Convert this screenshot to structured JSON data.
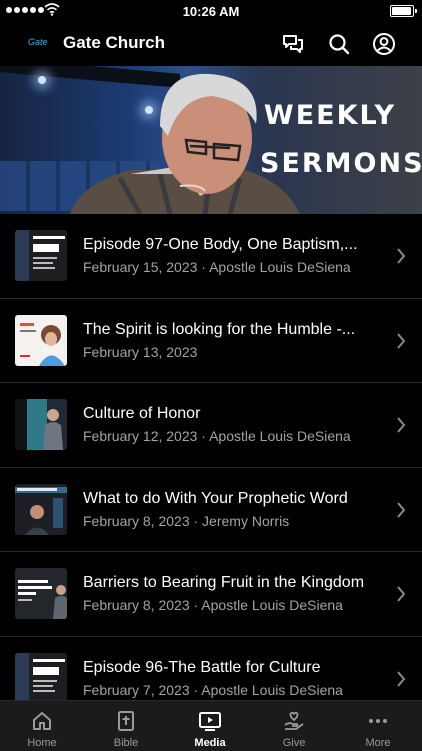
{
  "status_bar": {
    "time": "10:26 AM",
    "battery_level": 0.95
  },
  "header": {
    "logo_text": "Gate",
    "title": "Gate Church"
  },
  "hero": {
    "title_line1": "WEEKLY",
    "title_line2": "SERMONS"
  },
  "sermons": [
    {
      "title": "Episode 97-One Body, One Baptism,...",
      "subtitle": "February 15, 2023 · Apostle Louis DeSiena",
      "thumb": "outlook-thumbnail"
    },
    {
      "title": "The Spirit is looking for the Humble -...",
      "subtitle": "February 13, 2023",
      "thumb": "speaker-portrait-thumbnail"
    },
    {
      "title": "Culture of Honor",
      "subtitle": "February 12, 2023 · Apostle Louis DeSiena",
      "thumb": "stage-thumbnail"
    },
    {
      "title": "What to do With Your Prophetic Word",
      "subtitle": "February 8, 2023 · Jeremy Norris",
      "thumb": "narrow-door-thumbnail"
    },
    {
      "title": "Barriers to Bearing Fruit in the Kingdom",
      "subtitle": "February 8, 2023 · Apostle Louis DeSiena",
      "thumb": "barriers-thumbnail"
    },
    {
      "title": "Episode 96-The Battle for Culture",
      "subtitle": "February 7, 2023 · Apostle Louis DeSiena",
      "thumb": "outlook-thumbnail"
    }
  ],
  "tabs": [
    {
      "label": "Home",
      "icon": "home-icon"
    },
    {
      "label": "Bible",
      "icon": "bible-icon"
    },
    {
      "label": "Media",
      "icon": "media-icon",
      "active": true
    },
    {
      "label": "Give",
      "icon": "give-icon"
    },
    {
      "label": "More",
      "icon": "more-icon"
    }
  ],
  "colors": {
    "accent": "#3fb2e6",
    "background": "#000000",
    "tabbar": "#1b1b1b",
    "subtitle": "#a3a3a3"
  }
}
